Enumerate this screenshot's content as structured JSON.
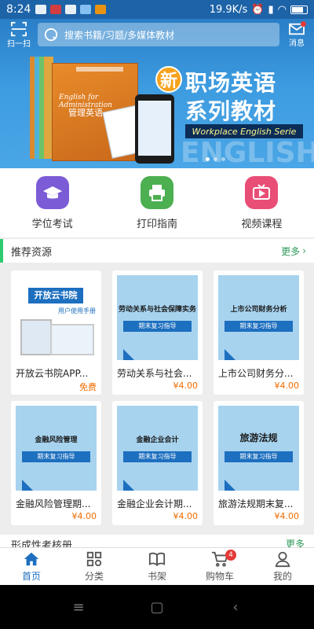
{
  "status_bar": {
    "time": "8:24",
    "speed": "19.9K/s"
  },
  "header": {
    "scan_label": "扫一扫",
    "search_placeholder": "搜索书籍/习题/多媒体教材",
    "message_label": "消息"
  },
  "banner": {
    "new_char": "新",
    "title_line1": "职场英语",
    "title_line2": "系列教材",
    "subtitle": "Workplace English Serie",
    "watermark": "ENGLISH",
    "book_title_en": "English for Administration",
    "book_title_cn": "管理英语"
  },
  "quick_nav": [
    {
      "label": "学位考试",
      "icon": "graduation-cap-icon",
      "color": "#7b5bd6"
    },
    {
      "label": "打印指南",
      "icon": "printer-icon",
      "color": "#4caf50"
    },
    {
      "label": "视频课程",
      "icon": "tv-icon",
      "color": "#e94e77"
    }
  ],
  "recommended": {
    "title": "推荐资源",
    "more": "更多",
    "items": [
      {
        "title": "开放云书院APP...",
        "price": "免费",
        "cover_title": "开放云书院",
        "cover_sub": "用户使用手册"
      },
      {
        "title": "劳动关系与社会...",
        "price": "¥4.00",
        "cover_title": "劳动关系与社会保障实务",
        "cover_sub": "期末复习指导"
      },
      {
        "title": "上市公司财务分...",
        "price": "¥4.00",
        "cover_title": "上市公司财务分析",
        "cover_sub": "期末复习指导"
      },
      {
        "title": "金融风险管理期...",
        "price": "¥4.00",
        "cover_title": "金融风险管理",
        "cover_sub": "期末复习指导"
      },
      {
        "title": "金融企业会计期...",
        "price": "¥4.00",
        "cover_title": "金融企业会计",
        "cover_sub": "期末复习指导"
      },
      {
        "title": "旅游法规期末复...",
        "price": "¥4.00",
        "cover_title": "旅游法规",
        "cover_sub": "期末复习指导"
      }
    ]
  },
  "next_section": {
    "title": "形成性考核册",
    "more": "更多"
  },
  "tabbar": [
    {
      "label": "首页",
      "active": true
    },
    {
      "label": "分类",
      "active": false
    },
    {
      "label": "书架",
      "active": false
    },
    {
      "label": "购物车",
      "active": false,
      "badge": "4"
    },
    {
      "label": "我的",
      "active": false
    }
  ],
  "android_nav": {
    "menu": "≡",
    "home": "▢",
    "back": "‹"
  }
}
